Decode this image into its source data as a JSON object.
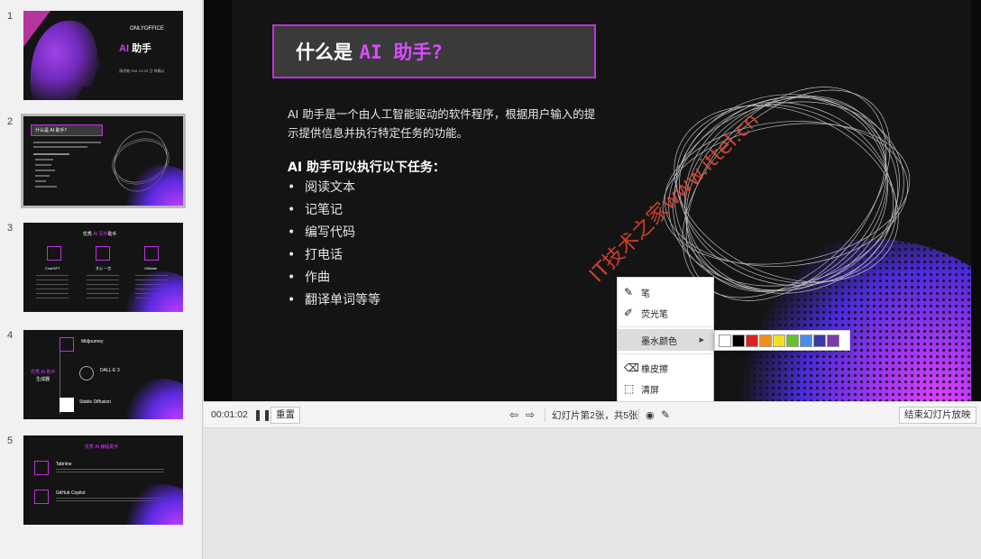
{
  "thumbnails": [
    {
      "num": "1",
      "brand": "ONLYOFFICE",
      "title_ai": "AI",
      "title_rest": "助手",
      "meta": "演讲者  ONL 03 03 日  待确认"
    },
    {
      "num": "2",
      "head": "什么是 AI 助手？"
    },
    {
      "num": "3",
      "head_a": "优秀",
      "head_b": "AI 写作",
      "head_c": "助手",
      "cols": [
        "ChatGPT",
        "文心 一言",
        "GitMate"
      ]
    },
    {
      "num": "4",
      "left_a": "优秀 AI 助手",
      "left_b": "生成器",
      "items": [
        "Midjourney",
        "DALL·E 3",
        "Stable Diffusion"
      ]
    },
    {
      "num": "5",
      "head": "优秀 AI 编程助手",
      "items": [
        "Tabnine",
        "GitHub Copilot"
      ]
    }
  ],
  "slide": {
    "title_a": "什么是",
    "title_hl": "AI 助手?",
    "intro": "AI 助手是一个由人工智能驱动的软件程序，根据用户输入的提示提供信息并执行特定任务的功能。",
    "tasks_head": "AI 助手可以执行以下任务：",
    "tasks": [
      "阅读文本",
      "记笔记",
      "编写代码",
      "打电话",
      "作曲",
      "翻译单词等等"
    ]
  },
  "watermark": "IT技术之家www.ittel.cn",
  "menu": {
    "pen": "笔",
    "highlighter": "荧光笔",
    "ink_color": "墨水颜色",
    "eraser": "橡皮擦",
    "clear": "清屏"
  },
  "palette": [
    "#ffffff",
    "#000000",
    "#e02020",
    "#f0901a",
    "#f2e020",
    "#66c02a",
    "#4a8ee6",
    "#3a3aa8",
    "#7a3aa8"
  ],
  "toolbar": {
    "timer": "00:01:02",
    "reset": "重置",
    "slide_info": "幻灯片第2张，共5张",
    "end_show": "结束幻灯片放映"
  }
}
